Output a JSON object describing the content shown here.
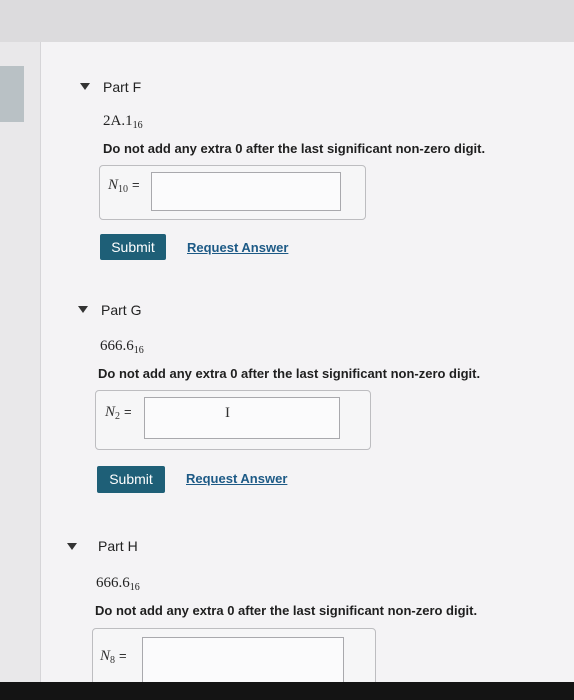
{
  "parts": [
    {
      "title": "Part F",
      "number_base": "2A.1",
      "number_sub": "16",
      "instruction": "Do not add any extra 0 after the last significant non-zero digit.",
      "var_main": "N",
      "var_sub": "10",
      "var_eq": "=",
      "input_value": "",
      "submit_label": "Submit",
      "request_label": "Request Answer"
    },
    {
      "title": "Part G",
      "number_base": "666.6",
      "number_sub": "16",
      "instruction": "Do not add any extra 0 after the last significant non-zero digit.",
      "var_main": "N",
      "var_sub": "2",
      "var_eq": "=",
      "input_value": "",
      "cursor_glyph": "I",
      "submit_label": "Submit",
      "request_label": "Request Answer"
    },
    {
      "title": "Part H",
      "number_base": "666.6",
      "number_sub": "16",
      "instruction": "Do not add any extra 0 after the last significant non-zero digit.",
      "var_main": "N",
      "var_sub": "8",
      "var_eq": "=",
      "input_value": ""
    }
  ],
  "colors": {
    "submit_bg": "#1e5f77",
    "link": "#1d5a86"
  }
}
